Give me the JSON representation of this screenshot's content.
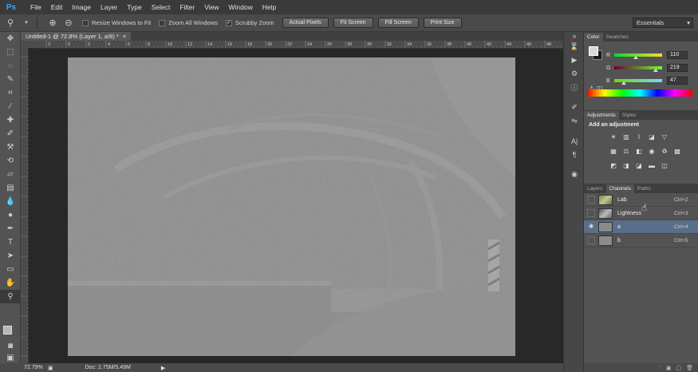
{
  "app": {
    "logo": "Ps"
  },
  "menu": [
    "File",
    "Edit",
    "Image",
    "Layer",
    "Type",
    "Select",
    "Filter",
    "View",
    "Window",
    "Help"
  ],
  "options": {
    "resize_windows": "Resize Windows to Fit",
    "zoom_all": "Zoom All Windows",
    "scrubby_zoom": "Scrubby Zoom",
    "actual_pixels": "Actual Pixels",
    "fit_screen": "Fit Screen",
    "fill_screen": "Fill Screen",
    "print_size": "Print Size",
    "workspace": "Essentials"
  },
  "document": {
    "tab_title": "Untitled-1 @ 72.8% (Layer 1, a/8) *",
    "zoom": "72.79%",
    "doc_size": "Doc: 2.75M/5.49M"
  },
  "ruler_labels": [
    "2",
    "0",
    "2",
    "4",
    "6",
    "8",
    "10",
    "12",
    "14",
    "16",
    "18",
    "20",
    "22",
    "24",
    "26",
    "28",
    "30",
    "32",
    "34",
    "36",
    "38",
    "40",
    "42",
    "44",
    "46",
    "48"
  ],
  "color_panel": {
    "tabs": [
      "Color",
      "Swatches"
    ],
    "channels": [
      {
        "label": "R",
        "value": "110"
      },
      {
        "label": "G",
        "value": "219"
      },
      {
        "label": "B",
        "value": "47"
      }
    ]
  },
  "adjustments": {
    "tabs": [
      "Adjustments",
      "Styles"
    ],
    "title": "Add an adjustment"
  },
  "layers_panel": {
    "tabs": [
      "Layers",
      "Channels",
      "Paths"
    ],
    "channels": [
      {
        "name": "Lab",
        "shortcut": "Ctrl+2"
      },
      {
        "name": "Lightness",
        "shortcut": "Ctrl+3"
      },
      {
        "name": "a",
        "shortcut": "Ctrl+4"
      },
      {
        "name": "b",
        "shortcut": "Ctrl+5"
      }
    ]
  },
  "colors": {
    "ps_blue": "#31a8ff",
    "selection": "#5a6d8a"
  }
}
